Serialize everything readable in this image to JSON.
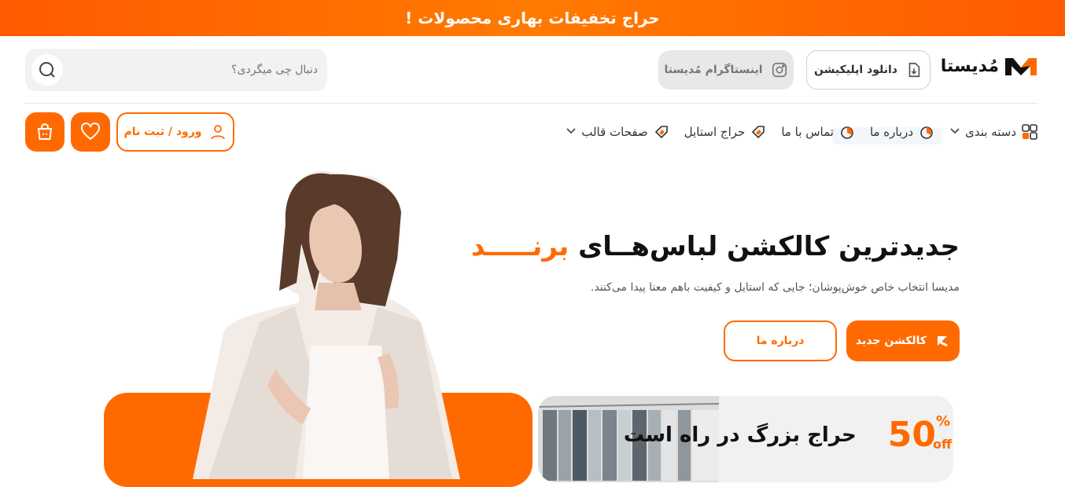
{
  "promo_bar": {
    "text": "حراج تخفیفات بهاری محصولات !"
  },
  "header": {
    "logo_text": "مُدیستا",
    "app_button_label": "دانلود اپلیکیشن",
    "instagram_button_label": "اینستاگرام مُدیستا",
    "search": {
      "placeholder": "دنبال چی میگردی؟"
    }
  },
  "nav": {
    "items": [
      {
        "label": "دسته بندی",
        "icon": "category-grid-icon",
        "has_dropdown": true
      },
      {
        "label": "درباره ما",
        "icon": "tag-icon"
      },
      {
        "label": "تماس با ما",
        "icon": "tag-icon"
      },
      {
        "label": "حراج استایل",
        "icon": "sale-tag-icon"
      },
      {
        "label": "صفحات قالب",
        "icon": "sale-tag-icon",
        "has_dropdown": true
      }
    ],
    "login_label": "ورود / ثبت نام"
  },
  "hero": {
    "title_main": "جدیدترین کالکشن لباس‌هــای ",
    "title_brand": "برنـــــد",
    "subtitle": "مدیسا انتخاب خاص خوش‌پوشان؛ جایی که استایل و کیفیت باهم معنا پیدا می‌کنند.",
    "primary_button": "کالکشن جدید",
    "secondary_button": "درباره ما"
  },
  "sale_banner": {
    "percent": "50",
    "percent_sign": "%",
    "off_text": "off",
    "label": "حراج بزرگ در راه است"
  },
  "colors": {
    "accent": "#ff6a00",
    "topbar": "#ff6200"
  }
}
